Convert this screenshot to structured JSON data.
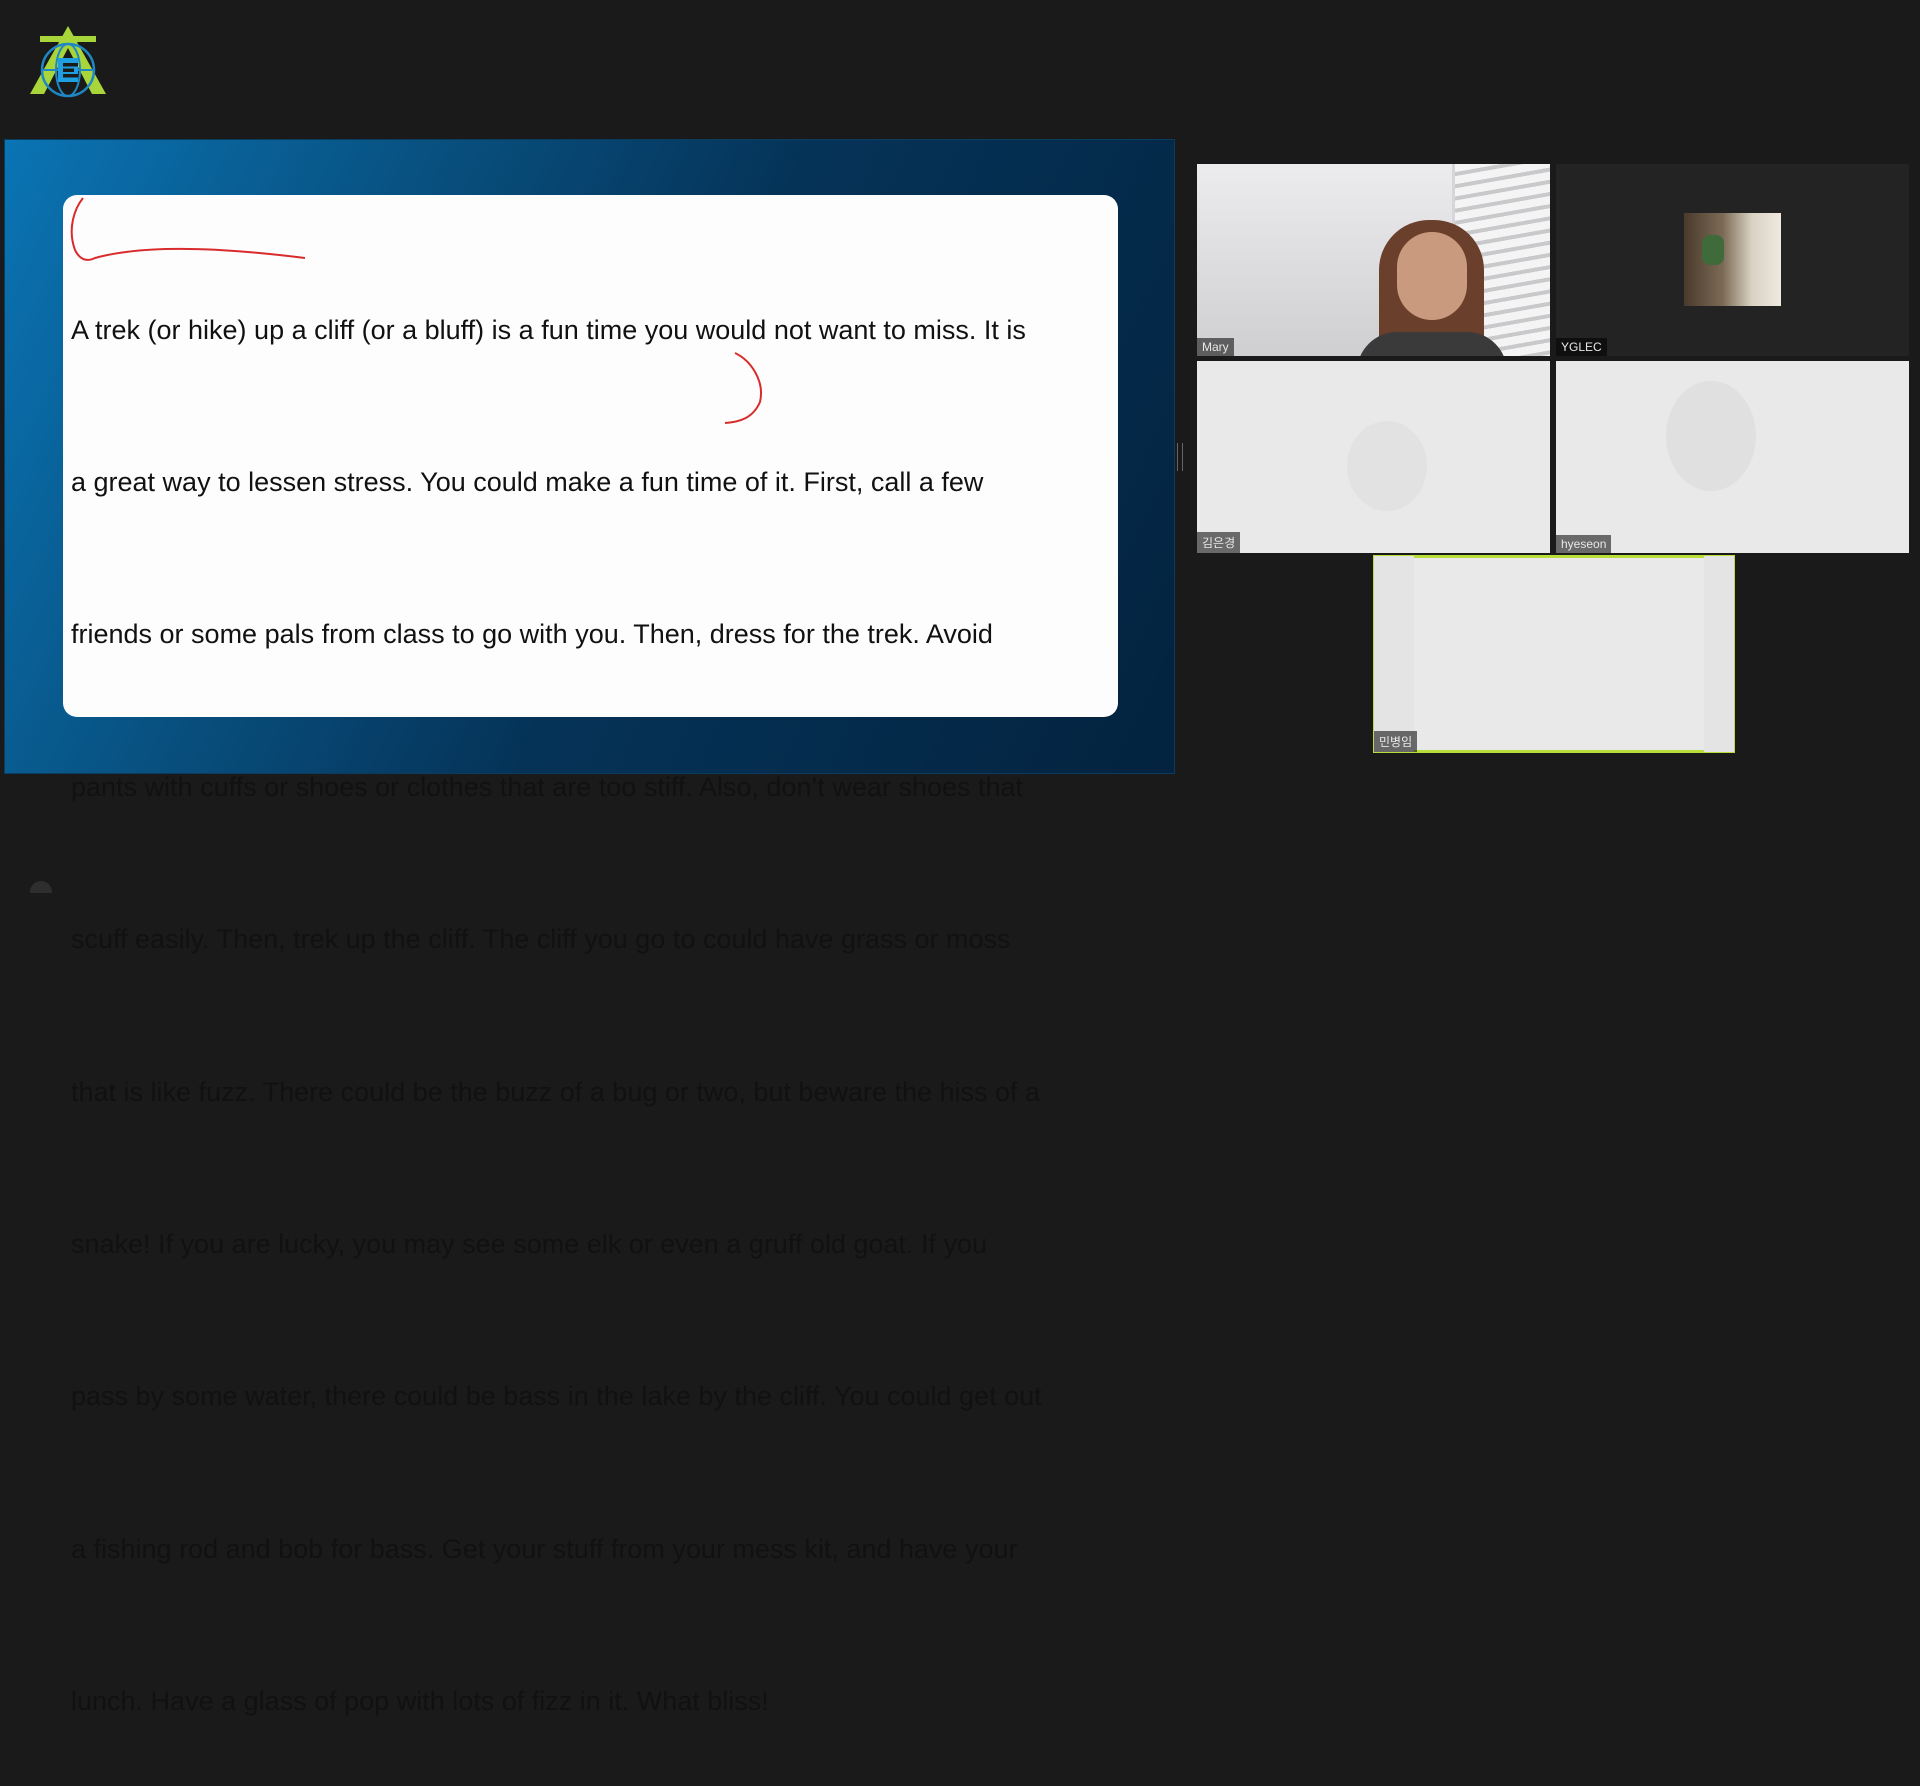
{
  "slide": {
    "lines": [
      "A trek (or hike) up a cliff (or a bluff) is a fun time you would not want to miss. It is",
      "a great way to lessen stress. You could make a fun time of it. First, call a few",
      "friends or some pals from class to go with you. Then, dress for the trek. Avoid",
      "pants with cuffs or shoes or clothes that are too stiff. Also, don’t wear shoes that",
      "scuff easily. Then, trek up the cliff. The cliff you go to could have grass or moss",
      "that is like fuzz. There could be the buzz of a bug or two, but beware the hiss of a",
      "snake! If you are lucky, you may see some elk or even a gruff old goat. If you",
      "pass by some water, there could be bass in the lake by the cliff. You could get out",
      "a fishing rod and bob for bass. Get your stuff from your mess kit, and have your",
      "lunch. Have a glass of pop with lots of fizz in it. What bliss!"
    ]
  },
  "participants": [
    {
      "name": "Mary"
    },
    {
      "name": "YGLEC"
    },
    {
      "name": "김은경"
    },
    {
      "name": "hyeseon"
    },
    {
      "name": "민병임"
    }
  ],
  "colors": {
    "active_speaker": "#b9de3a",
    "annotation": "#d92b2b",
    "background": "#1a1a1a"
  },
  "icons": [
    "app-logo-icon",
    "splitter-handle-icon"
  ]
}
